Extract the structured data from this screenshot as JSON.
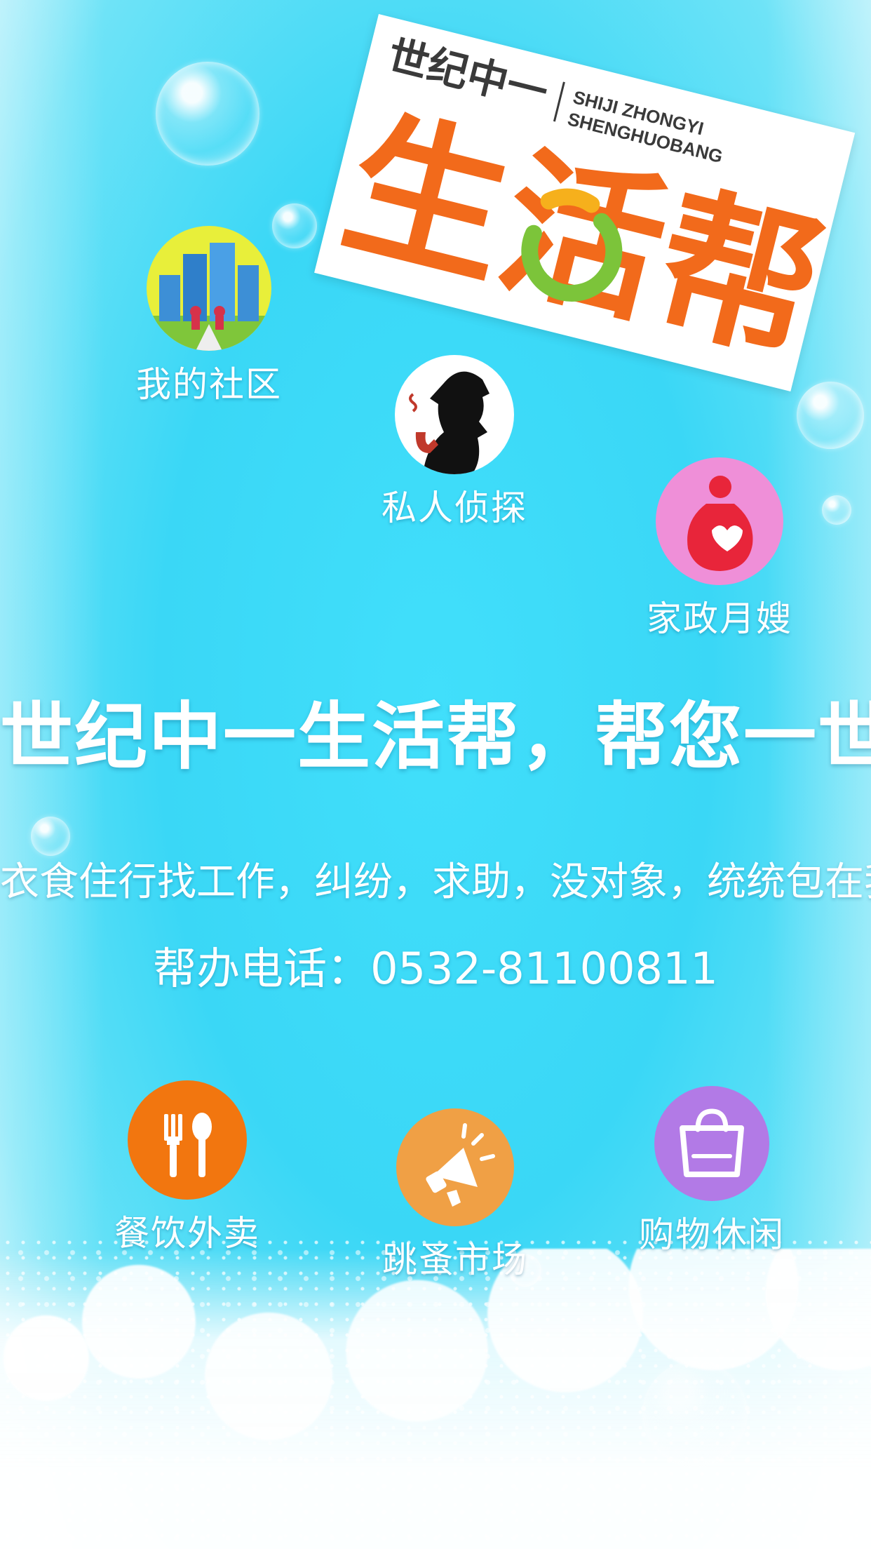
{
  "logo": {
    "brand_small": "世纪中一",
    "pinyin_line1": "SHIJI ZHONGYI",
    "pinyin_line2": "SHENGHUOBANG",
    "brand_large": "生活帮"
  },
  "features": {
    "community": {
      "label": "我的社区",
      "icon": "community-buildings-icon"
    },
    "detective": {
      "label": "私人侦探",
      "icon": "detective-silhouette-icon"
    },
    "housekeeping": {
      "label": "家政月嫂",
      "icon": "mother-baby-icon"
    },
    "food": {
      "label": "餐饮外卖",
      "icon": "fork-spoon-icon"
    },
    "flea": {
      "label": "跳蚤市场",
      "icon": "megaphone-icon"
    },
    "shopping": {
      "label": "购物休闲",
      "icon": "shopping-bag-icon"
    }
  },
  "texts": {
    "slogan": "世纪中一生活帮，帮您一世纪",
    "subline": "衣食住行找工作，纠纷，求助，没对象，统统包在我身上",
    "phone": "帮办电话：0532-81100811"
  },
  "colors": {
    "background": "#3ad7f6",
    "brand_orange": "#f26a1b",
    "food_orange": "#f2760f",
    "flea_orange": "#f0a045",
    "shopping_purple": "#b27ae6",
    "housekeeping_pink": "#ef8fd8",
    "community_yellow": "#e8ef3a"
  }
}
